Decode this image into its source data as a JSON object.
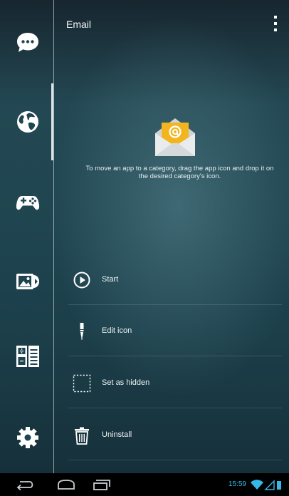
{
  "header": {
    "title": "Email",
    "menu_icon": "overflow-menu-icon"
  },
  "sidebar": {
    "categories": [
      {
        "name": "chat",
        "icon": "chat-bubble-icon"
      },
      {
        "name": "internet",
        "icon": "globe-icon",
        "active": true
      },
      {
        "name": "games",
        "icon": "gamepad-icon"
      },
      {
        "name": "media",
        "icon": "media-icon"
      },
      {
        "name": "office",
        "icon": "calculator-document-icon"
      },
      {
        "name": "settings",
        "icon": "gear-icon"
      }
    ]
  },
  "app": {
    "icon": "email-envelope-icon",
    "hint": "To move an app to a category, drag the app icon and drop it on the desired category's icon."
  },
  "actions": [
    {
      "label": "Start",
      "icon": "play-circle-icon"
    },
    {
      "label": "Edit icon",
      "icon": "brush-icon"
    },
    {
      "label": "Set as hidden",
      "icon": "dashed-square-icon"
    },
    {
      "label": "Uninstall",
      "icon": "trash-icon"
    }
  ],
  "status_bar": {
    "time": "15:59",
    "icons": [
      "wifi-icon",
      "signal-icon",
      "battery-icon"
    ]
  },
  "colors": {
    "accent": "#35b8e8",
    "envelope": "#f2b51f",
    "background": "#1f4550"
  }
}
